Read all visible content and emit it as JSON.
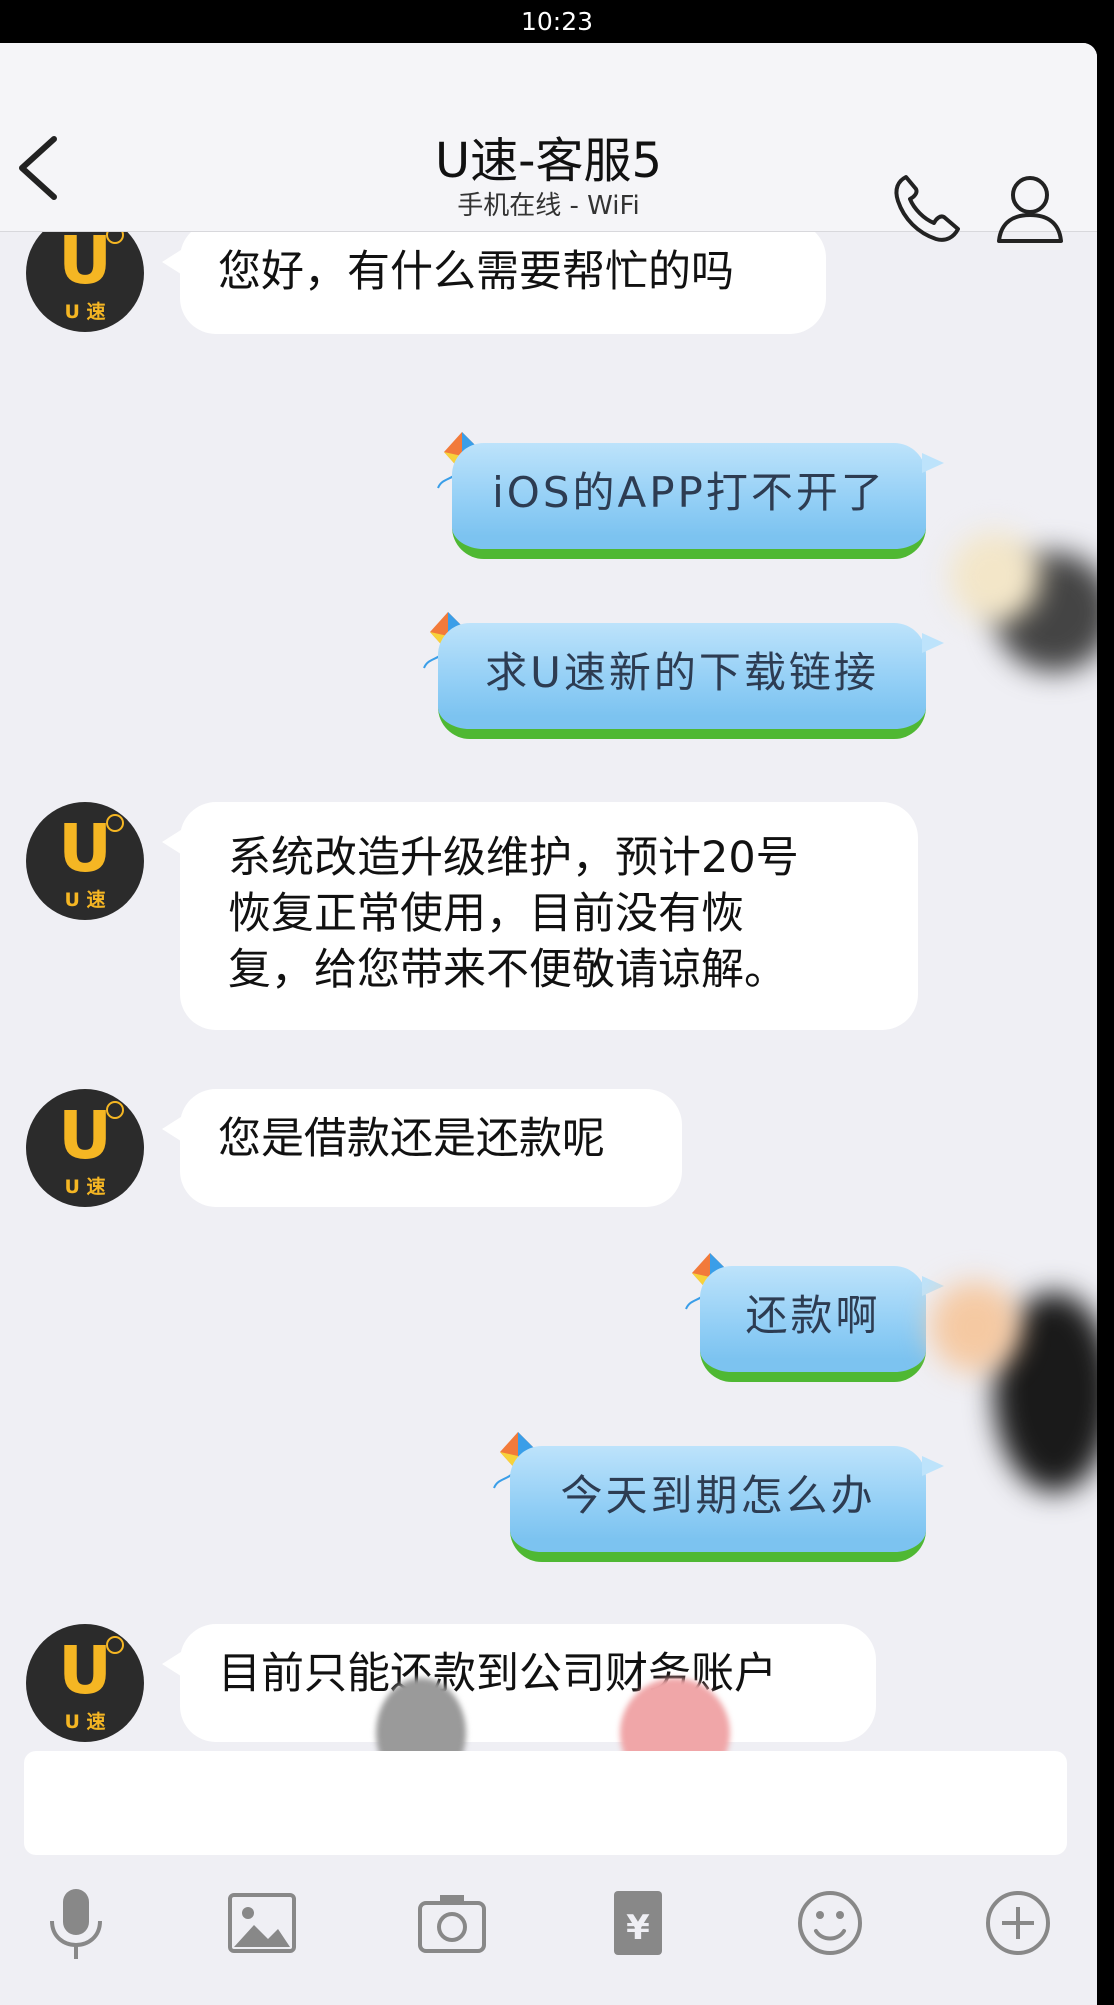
{
  "status_bar": {
    "time": "10:23"
  },
  "header": {
    "title": "U速-客服5",
    "subtitle": "手机在线 - WiFi"
  },
  "avatar": {
    "label": "U 速"
  },
  "messages": [
    {
      "side": "left",
      "text": "您好，有什么需要帮忙的吗"
    },
    {
      "side": "right",
      "text": "iOS的APP打不开了"
    },
    {
      "side": "right",
      "text": "求U速新的下载链接"
    },
    {
      "side": "left",
      "lines": [
        "系统改造升级维护，预计20号",
        "恢复正常使用，目前没有恢",
        "复，给您带来不便敬请谅解。"
      ]
    },
    {
      "side": "left",
      "text": "您是借款还是还款呢"
    },
    {
      "side": "right",
      "text": "还款啊"
    },
    {
      "side": "right",
      "text": "今天到期怎么办"
    },
    {
      "side": "left",
      "text": "目前只能还款到公司财务账户"
    }
  ],
  "input": {
    "value": ""
  },
  "toolbar": {
    "icons": [
      "microphone-icon",
      "image-icon",
      "camera-icon",
      "red-envelope-icon",
      "emoji-icon",
      "plus-icon"
    ]
  },
  "colors": {
    "background": "#efeff4",
    "right_bubble": "#8fcdf5",
    "right_bubble_border": "#4fb833",
    "avatar_accent": "#f5b623"
  }
}
